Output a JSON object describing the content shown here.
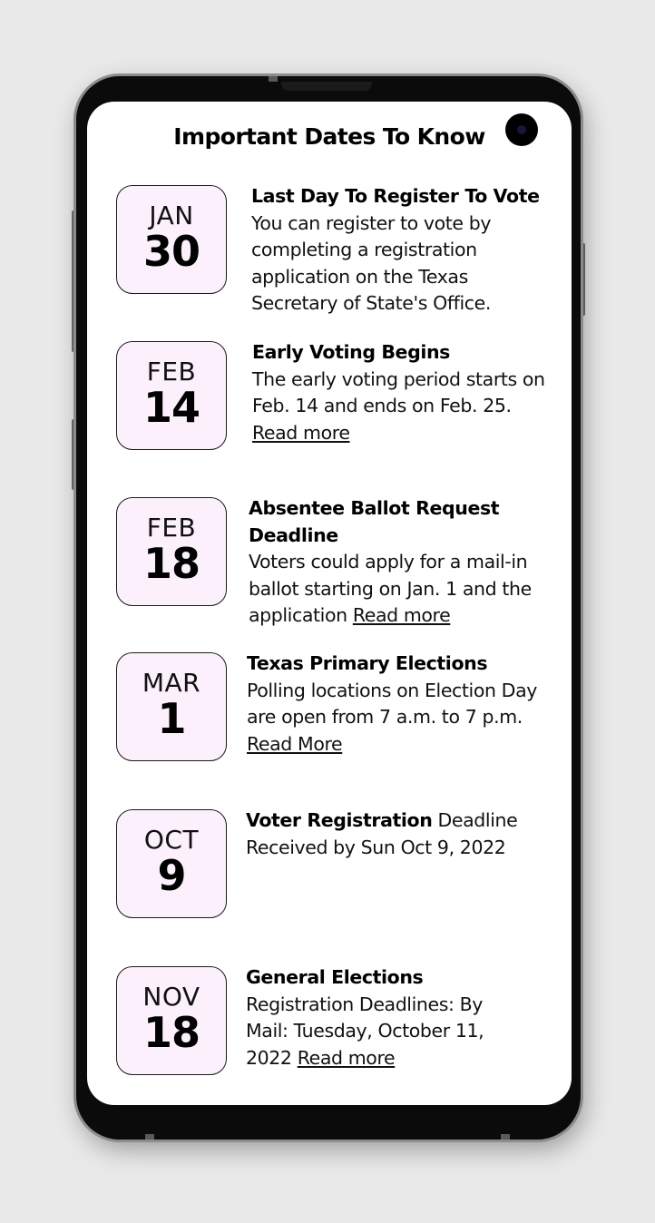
{
  "title": "Important Dates To Know",
  "events": [
    {
      "month": "JAN",
      "day": "30",
      "heading": "Last Day To Register To Vote",
      "description": "You can register to vote by completing a registration application on the Texas Secretary of State's Office.",
      "link": ""
    },
    {
      "month": "FEB",
      "day": "14",
      "heading": "Early Voting Begins",
      "description": "The early voting period starts on Feb. 14 and ends on Feb. 25.",
      "link": "Read more"
    },
    {
      "month": "FEB",
      "day": "18",
      "heading": "Absentee Ballot Request Deadline",
      "description": "Voters could apply for a mail-in ballot starting on Jan. 1 and the application",
      "link": "Read more"
    },
    {
      "month": "MAR",
      "day": "1",
      "heading": "Texas Primary Elections",
      "description": "Polling locations on Election Day are open from 7 a.m. to 7 p.m.",
      "link": "Read More"
    },
    {
      "month": "OCT",
      "day": "9",
      "heading": "Voter Registration",
      "description": "Deadline Received by Sun Oct 9, 2022",
      "link": ""
    },
    {
      "month": "NOV",
      "day": "18",
      "heading": "General Elections",
      "description": "Registration Deadlines: By Mail: Tuesday, October 11, 2022",
      "link": "Read more"
    }
  ]
}
